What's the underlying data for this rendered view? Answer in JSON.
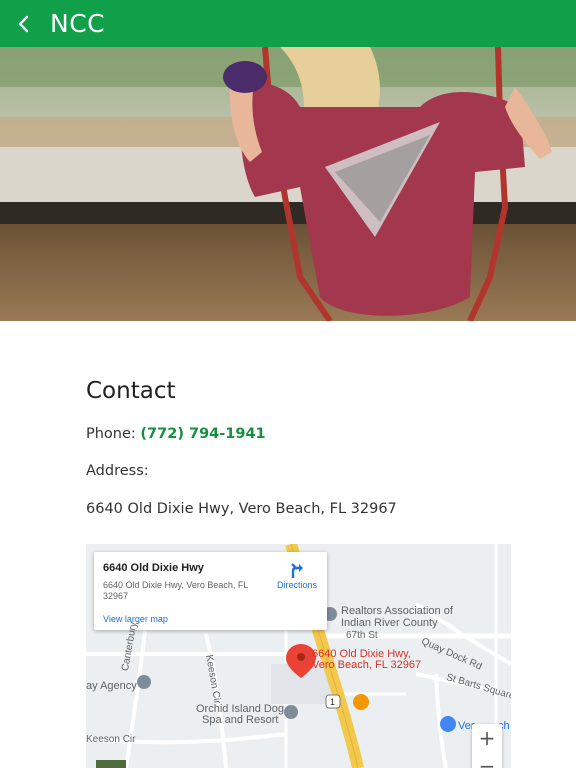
{
  "header": {
    "title": "NCC",
    "back_icon": "chevron-left-icon",
    "bg_color": "#10a04a"
  },
  "contact": {
    "heading": "Contact",
    "phone_label": "Phone:",
    "phone_number": "(772) 794-1941",
    "address_label": "Address:",
    "address_value": "6640 Old Dixie Hwy, Vero Beach, FL 32967"
  },
  "map": {
    "info_title": "6640 Old Dixie Hwy",
    "info_address": "6640 Old Dixie Hwy, Vero Beach, FL 32967",
    "view_larger": "View larger map",
    "directions": "Directions",
    "pin_label_line1": "6640 Old Dixie Hwy,",
    "pin_label_line2": "Vero Beach, FL 32967",
    "poi_realtors_1": "Realtors Association of",
    "poi_realtors_2": "Indian River County",
    "street_67th": "67th St",
    "street_quay": "Quay Dock Rd",
    "street_canterbury": "Canterbury",
    "street_keeson_cir": "Keeson Cir",
    "street_keeson_cir_2": "Keeson Cir",
    "street_barts": "St Barts Square",
    "poi_agency": "ay Agency",
    "poi_dogspa_1": "Orchid Island Dog",
    "poi_dogspa_2": "Spa and Resort",
    "poi_vero": "Ver",
    "poi_vero_tail": "ch",
    "route_number": "1",
    "zoom_in": "+",
    "zoom_out": "−"
  }
}
